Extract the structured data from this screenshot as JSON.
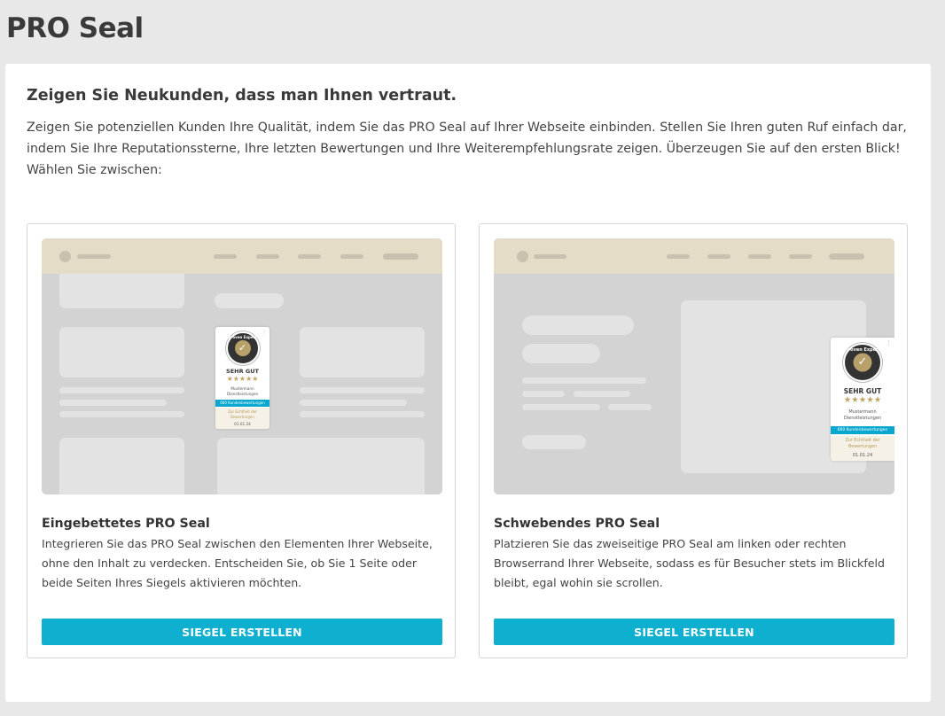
{
  "page": {
    "title": "PRO Seal"
  },
  "panel": {
    "headline": "Zeigen Sie Neukunden, dass man Ihnen vertraut.",
    "intro": "Zeigen Sie potenziellen Kunden Ihre Qualität, indem Sie das PRO Seal auf Ihrer Webseite einbinden. Stellen Sie Ihren guten Ruf einfach dar, indem Sie Ihre Reputationssterne, Ihre letzten Bewertungen und Ihre Weiterempfehlungsrate zeigen. Überzeugen Sie auf den ersten Blick! Wählen Sie zwischen:"
  },
  "seal_preview": {
    "brand_arc": "Proven Expert",
    "rating_label": "SEHR GUT",
    "stars": "★★★★★",
    "company_line1": "Mustermann",
    "company_line2": "Dienstleistungen",
    "count_embedded": "660 Kundenbewertungen",
    "count_floating": "660 Kundenbewertungen",
    "authenticity_line1": "Zur Echtheit der",
    "authenticity_line2": "Bewertungen",
    "date": "01.01.24",
    "menu_icon": "⋮"
  },
  "options": [
    {
      "title": "Eingebettetes PRO Seal",
      "description": "Integrieren Sie das PRO Seal zwischen den Elementen Ihrer Webseite, ohne den Inhalt zu verdecken. Entscheiden Sie, ob Sie 1 Seite oder beide Seiten Ihres Siegels aktivieren möchten.",
      "button": "SIEGEL ERSTELLEN"
    },
    {
      "title": "Schwebendes PRO Seal",
      "description": "Platzieren Sie das zweiseitige PRO Seal am linken oder rechten Browserrand Ihrer Webseite, sodass es für Besucher stets im Blickfeld bleibt, egal wohin sie scrollen.",
      "button": "SIEGEL ERSTELLEN"
    }
  ],
  "colors": {
    "accent": "#0eafcf",
    "mock_header": "#e3dcc6",
    "mock_body": "#d3d3d3",
    "star_gold": "#c0a464"
  }
}
